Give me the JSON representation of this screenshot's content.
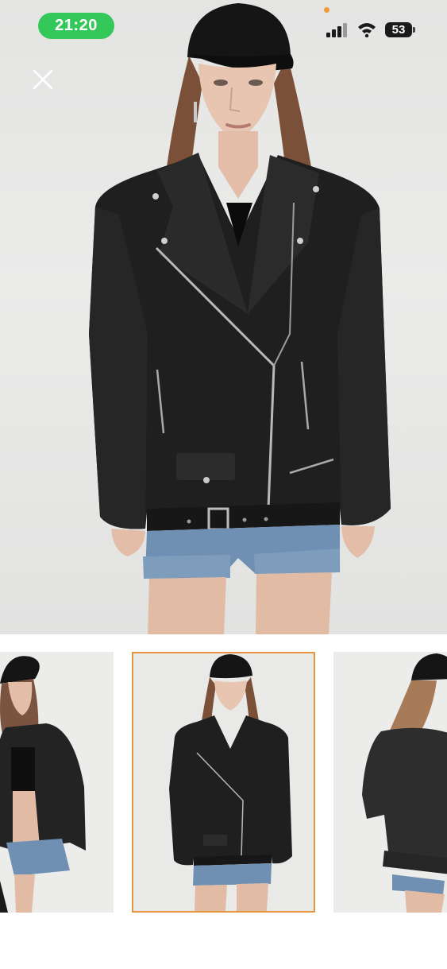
{
  "status_bar": {
    "time": "21:20",
    "battery": "53",
    "icons": [
      "signal-icon",
      "wifi-icon",
      "battery-icon"
    ]
  },
  "viewer": {
    "close_icon": "close-icon",
    "main_image": "leather-biker-jacket-front",
    "thumbnails": [
      {
        "name": "side-view",
        "selected": false
      },
      {
        "name": "front-view",
        "selected": true
      },
      {
        "name": "back-view",
        "selected": false
      }
    ]
  },
  "colors": {
    "time_pill": "#34c759",
    "thumbnail_selected_border": "#e6953f",
    "jacket": "#1f1f1f",
    "background": "#e8e8e7"
  }
}
